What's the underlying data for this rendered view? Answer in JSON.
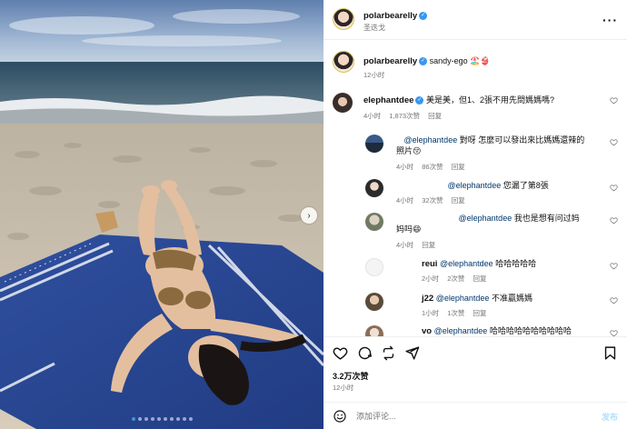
{
  "header": {
    "username": "polarbearelly",
    "location": "圣迭戈",
    "more_icon": "more-horizontal-icon"
  },
  "caption": {
    "username": "polarbearelly",
    "text": "sandy-ego 🏖️👙",
    "time": "12小时"
  },
  "comments": [
    {
      "username": "elephantdee",
      "verified": true,
      "text": "美是美，但1、2張不用先問媽媽嗎?",
      "time": "4小时",
      "likes": "1,873次赞",
      "reply": "回复"
    }
  ],
  "replies": [
    {
      "mention": "@elephantdee",
      "text": "對呀 怎麼可以發出來比媽媽還辣的照片😚",
      "time": "4小时",
      "likes": "86次赞",
      "reply": "回复"
    },
    {
      "mention": "@elephantdee",
      "text": "您漏了第8張",
      "time": "4小时",
      "likes": "32次赞",
      "reply": "回复"
    },
    {
      "mention": "@elephantdee",
      "text": "我也是想有问过妈妈吗😄",
      "time": "4小时",
      "likes": "",
      "reply": "回复"
    },
    {
      "username": "reui",
      "mention": "@elephantdee",
      "text": "哈哈哈哈哈",
      "time": "2小时",
      "likes": "2次赞",
      "reply": "回复"
    },
    {
      "username": "j22",
      "mention": "@elephantdee",
      "text": "不准贏媽媽",
      "time": "1小时",
      "likes": "1次赞",
      "reply": "回复"
    },
    {
      "username": "vo",
      "mention": "@elephantdee",
      "text": "哈哈哈哈哈哈哈哈哈哈"
    }
  ],
  "actions": {
    "likes_count": "3.2万次赞",
    "post_time": "12小时"
  },
  "composer": {
    "placeholder": "添加评论...",
    "post_label": "发布"
  },
  "carousel": {
    "total": 10,
    "active": 0
  },
  "colors": {
    "verified": "#3897f0",
    "mention": "#00376b",
    "muted": "#737373",
    "dot_active": "#4a90d9"
  }
}
